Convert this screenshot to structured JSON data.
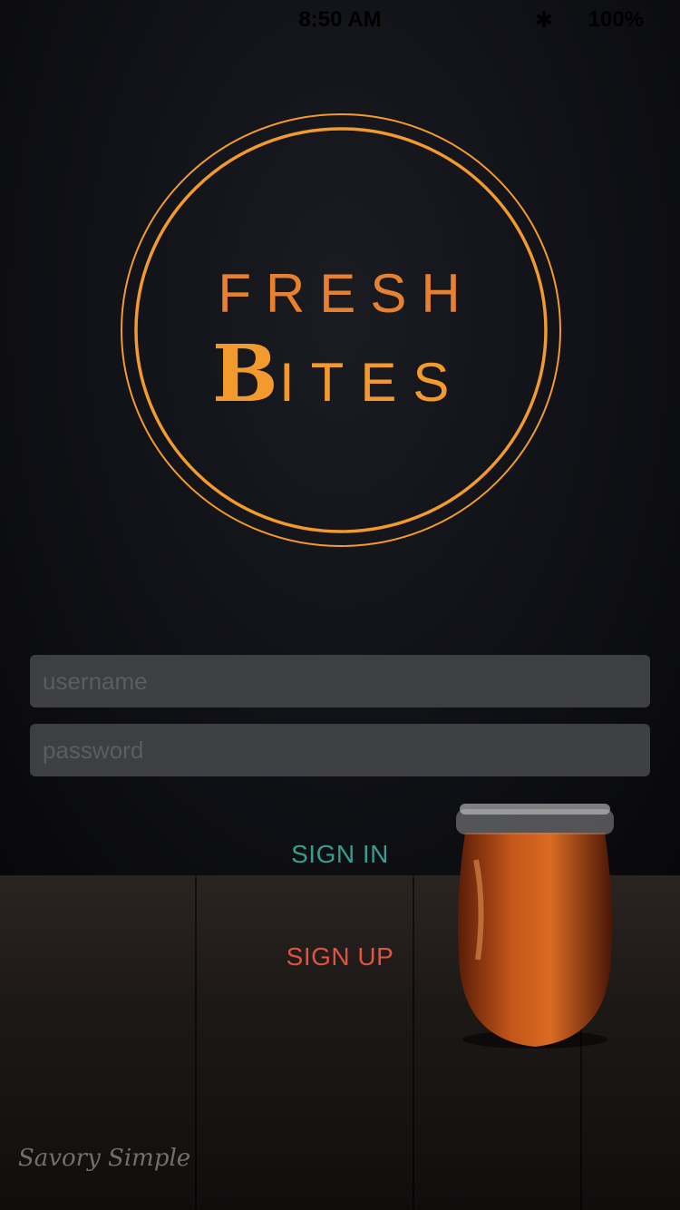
{
  "status_bar": {
    "time": "8:50 AM",
    "battery": "100%"
  },
  "logo": {
    "line1": "FRESH",
    "line2_initial": "B",
    "line2_rest": "ITES",
    "ring_color": "#f29a2e",
    "text_color": "#e8812f"
  },
  "form": {
    "username_placeholder": "username",
    "password_placeholder": "password"
  },
  "actions": {
    "sign_in": "SIGN IN",
    "sign_up": "SIGN UP",
    "sign_in_color": "#3a9c8e",
    "sign_up_color": "#e0533e"
  },
  "watermark": "Savory Simple"
}
